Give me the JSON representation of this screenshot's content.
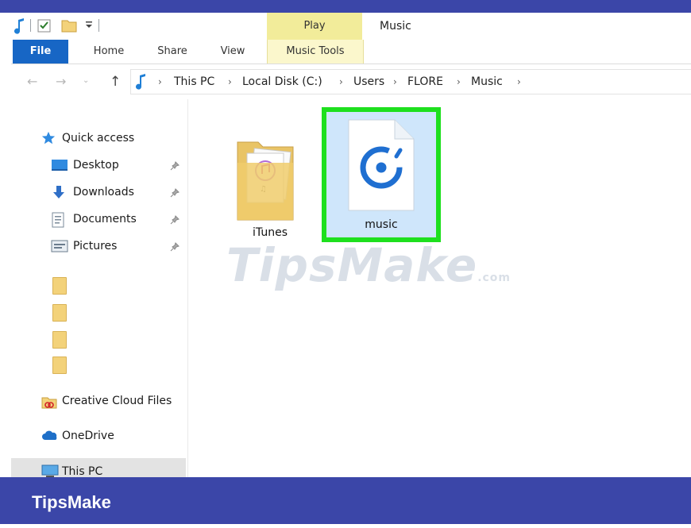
{
  "window": {
    "title": "Music",
    "contextual_tab_group": "Play"
  },
  "ribbon": {
    "tabs": [
      {
        "label": "File",
        "active": true
      },
      {
        "label": "Home"
      },
      {
        "label": "Share"
      },
      {
        "label": "View"
      },
      {
        "label": "Music Tools"
      }
    ]
  },
  "address": {
    "breadcrumbs": [
      "This PC",
      "Local Disk (C:)",
      "Users",
      "FLORE",
      "Music"
    ]
  },
  "nav_pane": {
    "quick_access": "Quick access",
    "pinned": [
      {
        "label": "Desktop",
        "icon": "desktop-icon"
      },
      {
        "label": "Downloads",
        "icon": "downloads-icon"
      },
      {
        "label": "Documents",
        "icon": "documents-icon"
      },
      {
        "label": "Pictures",
        "icon": "pictures-icon"
      }
    ],
    "unnamed_folders": 4,
    "creative_cloud": "Creative Cloud Files",
    "onedrive": "OneDrive",
    "this_pc": "This PC"
  },
  "content": {
    "items": [
      {
        "label": "iTunes",
        "icon": "itunes-folder-icon"
      },
      {
        "label": "music",
        "icon": "groove-music-icon",
        "selected": true
      }
    ]
  },
  "watermark": {
    "text": "TipsMake",
    "suffix": ".com"
  },
  "banner": {
    "text": "TipsMake"
  },
  "colors": {
    "file_tab": "#1766c5",
    "play_tab": "#f2ec9a",
    "selection_highlight": "#1ee01e",
    "selection_fill": "#cfe6fb",
    "banner": "#3b46a8"
  }
}
